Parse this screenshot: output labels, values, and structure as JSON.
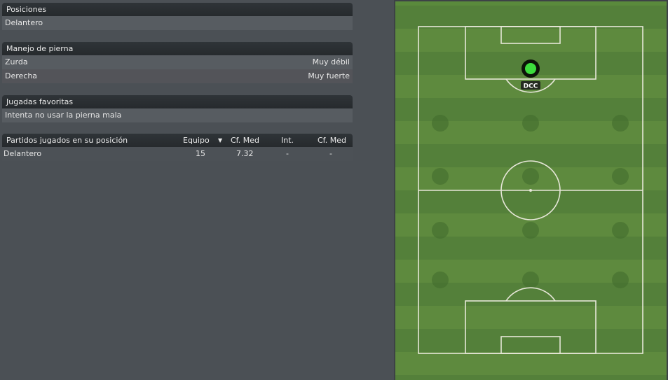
{
  "positions": {
    "title": "Posiciones",
    "value": "Delantero"
  },
  "footedness": {
    "title": "Manejo de pierna",
    "rows": [
      {
        "label": "Zurda",
        "value": "Muy débil"
      },
      {
        "label": "Derecha",
        "value": "Muy fuerte"
      }
    ]
  },
  "favorite_moves": {
    "title": "Jugadas favoritas",
    "value": "Intenta no usar la pierna mala"
  },
  "matches_table": {
    "columns": [
      "Partidos jugados en su posición",
      "Equipo",
      "Cf. Med",
      "Int.",
      "Cf. Med"
    ],
    "sort_indicator": "▼",
    "rows": [
      {
        "position": "Delantero",
        "team": "15",
        "rating": "7.32",
        "int": "-",
        "int_rating": "-"
      }
    ]
  },
  "pitch": {
    "player_label": "DCC",
    "player_color": "#3ddc3d",
    "grass_light": "#5e8a3e",
    "grass_dark": "#54803a"
  }
}
